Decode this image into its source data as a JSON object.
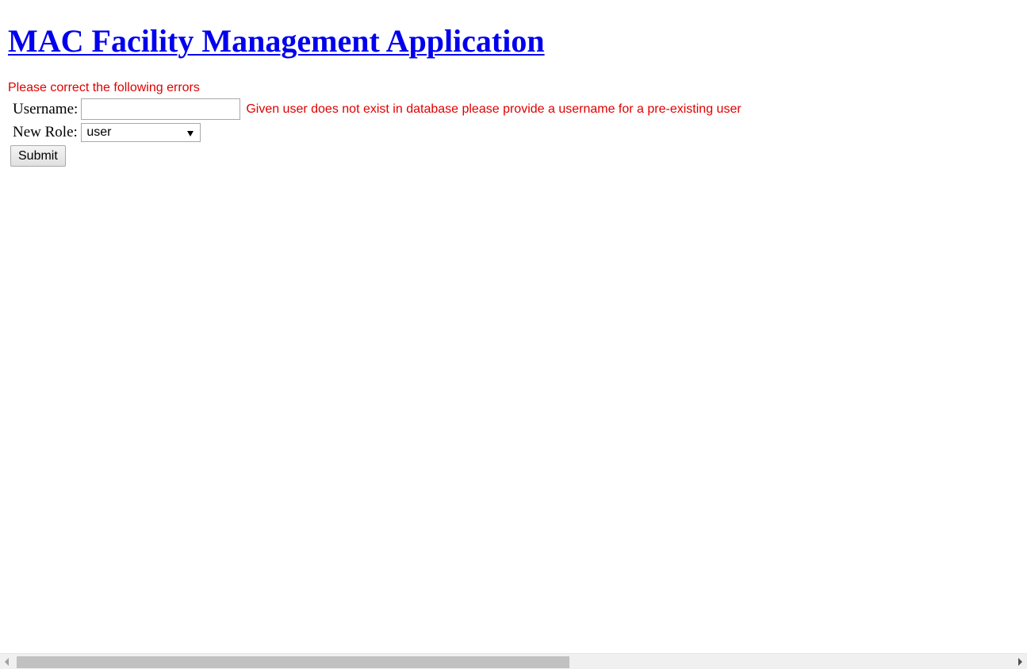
{
  "header": {
    "title": "MAC Facility Management Application"
  },
  "errors": {
    "summary": "Please correct the following errors",
    "username": "Given user does not exist in database please provide a username for a pre-existing user"
  },
  "form": {
    "username_label": "Username:",
    "username_value": "",
    "role_label": "New Role:",
    "role_selected": "user",
    "submit_label": "Submit"
  },
  "icons": {
    "dropdown": "chevron-down-icon",
    "scroll_left": "chevron-left-icon",
    "scroll_right": "chevron-right-icon"
  }
}
